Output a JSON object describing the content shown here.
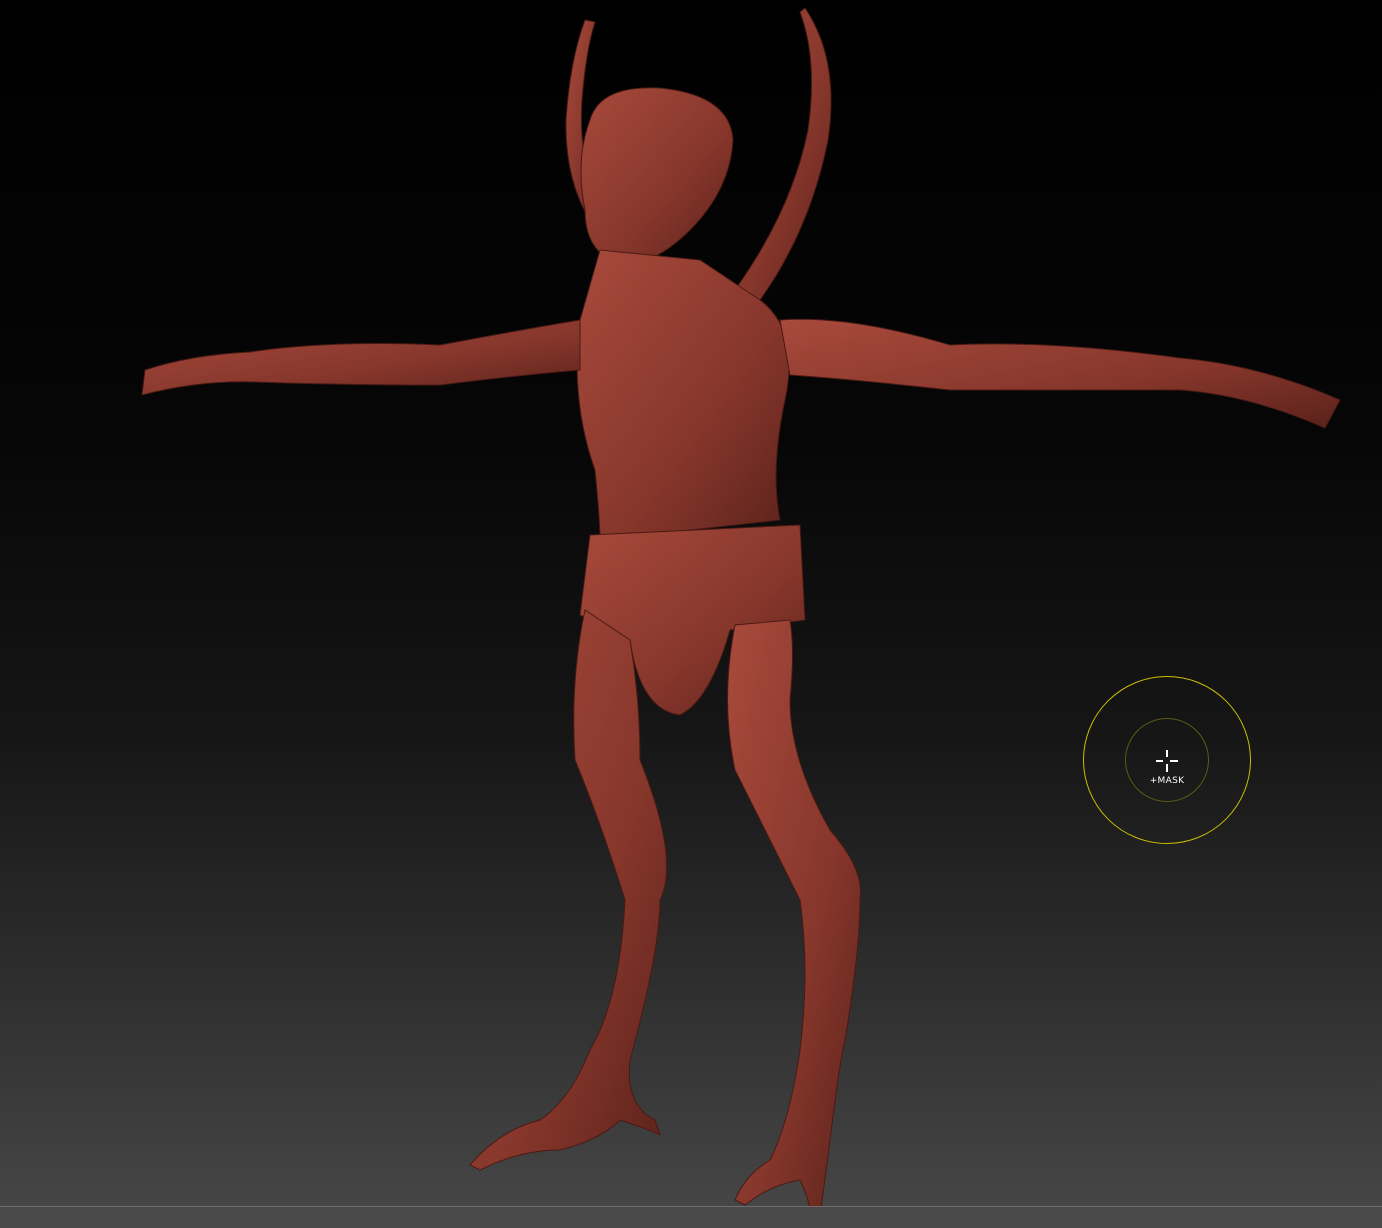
{
  "viewport": {
    "model_color": "#8e3a2e",
    "brush_cursor": {
      "label": "+MASK",
      "outer_ring_color": "#c8c000",
      "inner_ring_color": "#5e5a14"
    }
  }
}
